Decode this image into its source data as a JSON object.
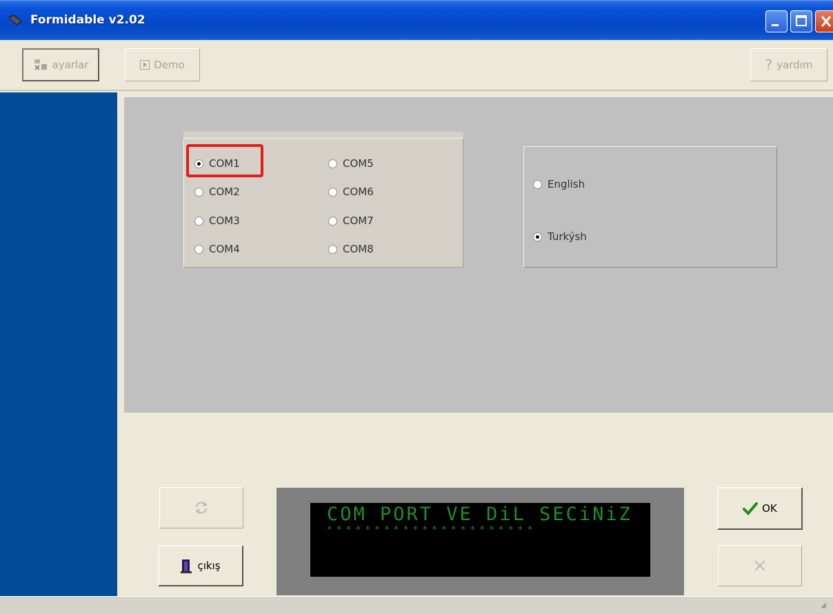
{
  "window": {
    "title": "Formidable v2.02"
  },
  "toolbar": {
    "ayarlar_label": "ayarlar",
    "demo_label": "Demo",
    "yardim_label": "yardım"
  },
  "com_ports": {
    "options": [
      "COM1",
      "COM2",
      "COM3",
      "COM4",
      "COM5",
      "COM6",
      "COM7",
      "COM8"
    ],
    "selected": "COM1"
  },
  "language": {
    "options": [
      "English",
      "Turkýsh"
    ],
    "selected": "Turkýsh"
  },
  "lcd": {
    "line1": "COM PORT VE DiL SECiNiZ",
    "line2": "**********************"
  },
  "buttons": {
    "cikis_label": "çıkış",
    "ok_label": "OK"
  },
  "colors": {
    "titlebar": "#0548c8",
    "leftbar": "#004c98",
    "content_gray": "#c0c0c0",
    "lcd_text": "#1f8f28",
    "highlight": "#e41c1c"
  }
}
